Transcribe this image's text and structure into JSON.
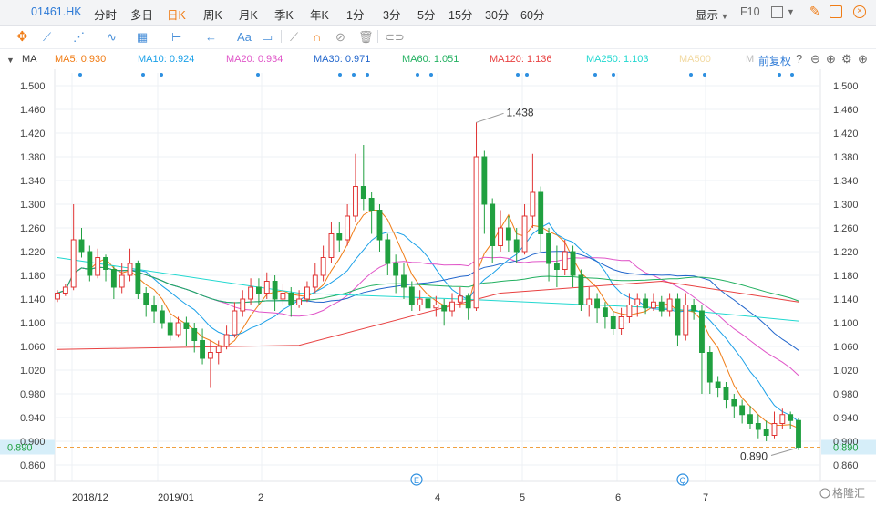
{
  "tabs": {
    "symbol": "01461.HK",
    "periods": [
      "分时",
      "多日",
      "日K",
      "周K",
      "月K",
      "季K",
      "年K",
      "1分",
      "3分",
      "5分",
      "15分",
      "30分",
      "60分"
    ],
    "active": "日K",
    "display_label": "显示",
    "f10_label": "F10"
  },
  "toolbar": {
    "text_tool": "Aa"
  },
  "ma_bar": {
    "label": "MA",
    "items": [
      {
        "text": "MA5: 0.930",
        "color": "#f07c15"
      },
      {
        "text": "MA10: 0.924",
        "color": "#1aa0e8"
      },
      {
        "text": "MA20: 0.934",
        "color": "#e055c8"
      },
      {
        "text": "MA30: 0.971",
        "color": "#2266cc"
      },
      {
        "text": "MA60: 1.051",
        "color": "#22b060"
      },
      {
        "text": "MA120: 1.136",
        "color": "#e84040"
      },
      {
        "text": "MA250: 1.103",
        "color": "#22d8d0"
      },
      {
        "text": "MA500",
        "color": "#f2d9a0"
      },
      {
        "text": "M",
        "color": "#bbbbbb"
      }
    ],
    "adjust_label": "前复权"
  },
  "chart_data": {
    "type": "candlestick",
    "y_ticks": [
      "1.500",
      "1.460",
      "1.420",
      "1.380",
      "1.340",
      "1.300",
      "1.260",
      "1.220",
      "1.180",
      "1.140",
      "1.100",
      "1.060",
      "1.020",
      "0.980",
      "0.940",
      "0.900",
      "0.860"
    ],
    "ylim": [
      0.84,
      1.52
    ],
    "x_labels": [
      "2018/12",
      "2019/01",
      "2",
      "4",
      "5",
      "6",
      "7"
    ],
    "current_price": "0.890",
    "high_annotation": "1.438",
    "low_annotation": "0.890",
    "event_markers": [
      "E",
      "Q"
    ],
    "watermark": "格隆汇",
    "colors": {
      "up": "#e03434",
      "down": "#20a040"
    },
    "candles": [
      [
        1.14,
        1.15,
        1.155,
        1.135
      ],
      [
        1.15,
        1.16,
        1.165,
        1.145
      ],
      [
        1.16,
        1.24,
        1.3,
        1.155
      ],
      [
        1.24,
        1.22,
        1.26,
        1.21
      ],
      [
        1.22,
        1.18,
        1.23,
        1.17
      ],
      [
        1.18,
        1.21,
        1.225,
        1.175
      ],
      [
        1.21,
        1.19,
        1.215,
        1.17
      ],
      [
        1.19,
        1.16,
        1.195,
        1.14
      ],
      [
        1.16,
        1.18,
        1.2,
        1.15
      ],
      [
        1.18,
        1.2,
        1.225,
        1.17
      ],
      [
        1.2,
        1.15,
        1.205,
        1.14
      ],
      [
        1.15,
        1.13,
        1.16,
        1.11
      ],
      [
        1.13,
        1.12,
        1.145,
        1.1
      ],
      [
        1.12,
        1.1,
        1.13,
        1.09
      ],
      [
        1.1,
        1.08,
        1.11,
        1.07
      ],
      [
        1.08,
        1.1,
        1.11,
        1.075
      ],
      [
        1.1,
        1.09,
        1.11,
        1.06
      ],
      [
        1.09,
        1.07,
        1.1,
        1.05
      ],
      [
        1.07,
        1.04,
        1.09,
        1.03
      ],
      [
        1.04,
        1.05,
        1.07,
        0.99
      ],
      [
        1.05,
        1.06,
        1.07,
        1.03
      ],
      [
        1.06,
        1.08,
        1.095,
        1.055
      ],
      [
        1.08,
        1.12,
        1.135,
        1.075
      ],
      [
        1.12,
        1.14,
        1.155,
        1.11
      ],
      [
        1.14,
        1.16,
        1.175,
        1.13
      ],
      [
        1.16,
        1.15,
        1.175,
        1.13
      ],
      [
        1.15,
        1.17,
        1.185,
        1.14
      ],
      [
        1.17,
        1.14,
        1.18,
        1.12
      ],
      [
        1.14,
        1.15,
        1.165,
        1.13
      ],
      [
        1.15,
        1.13,
        1.16,
        1.11
      ],
      [
        1.13,
        1.14,
        1.155,
        1.125
      ],
      [
        1.14,
        1.16,
        1.17,
        1.135
      ],
      [
        1.16,
        1.18,
        1.2,
        1.15
      ],
      [
        1.18,
        1.21,
        1.23,
        1.17
      ],
      [
        1.21,
        1.25,
        1.27,
        1.2
      ],
      [
        1.25,
        1.24,
        1.27,
        1.22
      ],
      [
        1.24,
        1.28,
        1.3,
        1.23
      ],
      [
        1.28,
        1.33,
        1.385,
        1.27
      ],
      [
        1.33,
        1.31,
        1.4,
        1.29
      ],
      [
        1.31,
        1.29,
        1.32,
        1.25
      ],
      [
        1.29,
        1.24,
        1.3,
        1.22
      ],
      [
        1.24,
        1.2,
        1.25,
        1.18
      ],
      [
        1.2,
        1.18,
        1.215,
        1.15
      ],
      [
        1.18,
        1.16,
        1.2,
        1.14
      ],
      [
        1.16,
        1.13,
        1.17,
        1.12
      ],
      [
        1.13,
        1.14,
        1.155,
        1.12
      ],
      [
        1.14,
        1.125,
        1.15,
        1.11
      ],
      [
        1.125,
        1.13,
        1.145,
        1.11
      ],
      [
        1.13,
        1.12,
        1.14,
        1.095
      ],
      [
        1.12,
        1.135,
        1.15,
        1.11
      ],
      [
        1.135,
        1.145,
        1.16,
        1.125
      ],
      [
        1.145,
        1.125,
        1.15,
        1.105
      ],
      [
        1.125,
        1.38,
        1.438,
        1.12
      ],
      [
        1.38,
        1.3,
        1.39,
        1.25
      ],
      [
        1.3,
        1.23,
        1.31,
        1.2
      ],
      [
        1.23,
        1.26,
        1.29,
        1.22
      ],
      [
        1.26,
        1.24,
        1.28,
        1.22
      ],
      [
        1.24,
        1.22,
        1.26,
        1.2
      ],
      [
        1.22,
        1.28,
        1.3,
        1.215
      ],
      [
        1.28,
        1.32,
        1.385,
        1.26
      ],
      [
        1.32,
        1.25,
        1.33,
        1.22
      ],
      [
        1.25,
        1.2,
        1.26,
        1.17
      ],
      [
        1.2,
        1.19,
        1.23,
        1.16
      ],
      [
        1.19,
        1.22,
        1.24,
        1.18
      ],
      [
        1.22,
        1.18,
        1.23,
        1.16
      ],
      [
        1.18,
        1.13,
        1.19,
        1.12
      ],
      [
        1.13,
        1.14,
        1.16,
        1.11
      ],
      [
        1.14,
        1.125,
        1.15,
        1.1
      ],
      [
        1.125,
        1.11,
        1.135,
        1.09
      ],
      [
        1.11,
        1.09,
        1.12,
        1.08
      ],
      [
        1.09,
        1.11,
        1.125,
        1.08
      ],
      [
        1.11,
        1.13,
        1.15,
        1.1
      ],
      [
        1.13,
        1.14,
        1.15,
        1.11
      ],
      [
        1.14,
        1.125,
        1.15,
        1.115
      ],
      [
        1.125,
        1.135,
        1.15,
        1.12
      ],
      [
        1.135,
        1.12,
        1.145,
        1.11
      ],
      [
        1.12,
        1.14,
        1.15,
        1.11
      ],
      [
        1.14,
        1.08,
        1.15,
        1.06
      ],
      [
        1.08,
        1.13,
        1.15,
        1.07
      ],
      [
        1.13,
        1.12,
        1.14,
        1.105
      ],
      [
        1.12,
        1.05,
        1.13,
        0.98
      ],
      [
        1.05,
        1.0,
        1.06,
        0.98
      ],
      [
        1.0,
        0.99,
        1.01,
        0.975
      ],
      [
        0.99,
        0.97,
        1.0,
        0.955
      ],
      [
        0.97,
        0.96,
        0.98,
        0.94
      ],
      [
        0.96,
        0.945,
        0.97,
        0.93
      ],
      [
        0.945,
        0.93,
        0.96,
        0.92
      ],
      [
        0.93,
        0.92,
        0.945,
        0.905
      ],
      [
        0.92,
        0.91,
        0.935,
        0.9
      ],
      [
        0.91,
        0.93,
        0.95,
        0.905
      ],
      [
        0.93,
        0.945,
        0.955,
        0.92
      ],
      [
        0.945,
        0.935,
        0.95,
        0.92
      ],
      [
        0.935,
        0.89,
        0.94,
        0.885
      ]
    ],
    "ma_lines": [
      {
        "name": "MA5",
        "color": "#f07c15"
      },
      {
        "name": "MA10",
        "color": "#1aa0e8"
      },
      {
        "name": "MA20",
        "color": "#e055c8"
      },
      {
        "name": "MA30",
        "color": "#2266cc"
      },
      {
        "name": "MA60",
        "color": "#22b060"
      },
      {
        "name": "MA120",
        "color": "#e84040",
        "points": [
          [
            0,
            1.055
          ],
          [
            30,
            1.062
          ],
          [
            55,
            1.15
          ],
          [
            75,
            1.17
          ],
          [
            92,
            1.135
          ]
        ]
      },
      {
        "name": "MA250",
        "color": "#22d8d0",
        "points": [
          [
            0,
            1.21
          ],
          [
            30,
            1.15
          ],
          [
            50,
            1.14
          ],
          [
            75,
            1.125
          ],
          [
            92,
            1.103
          ]
        ]
      }
    ]
  },
  "watermark_text": "格隆汇"
}
